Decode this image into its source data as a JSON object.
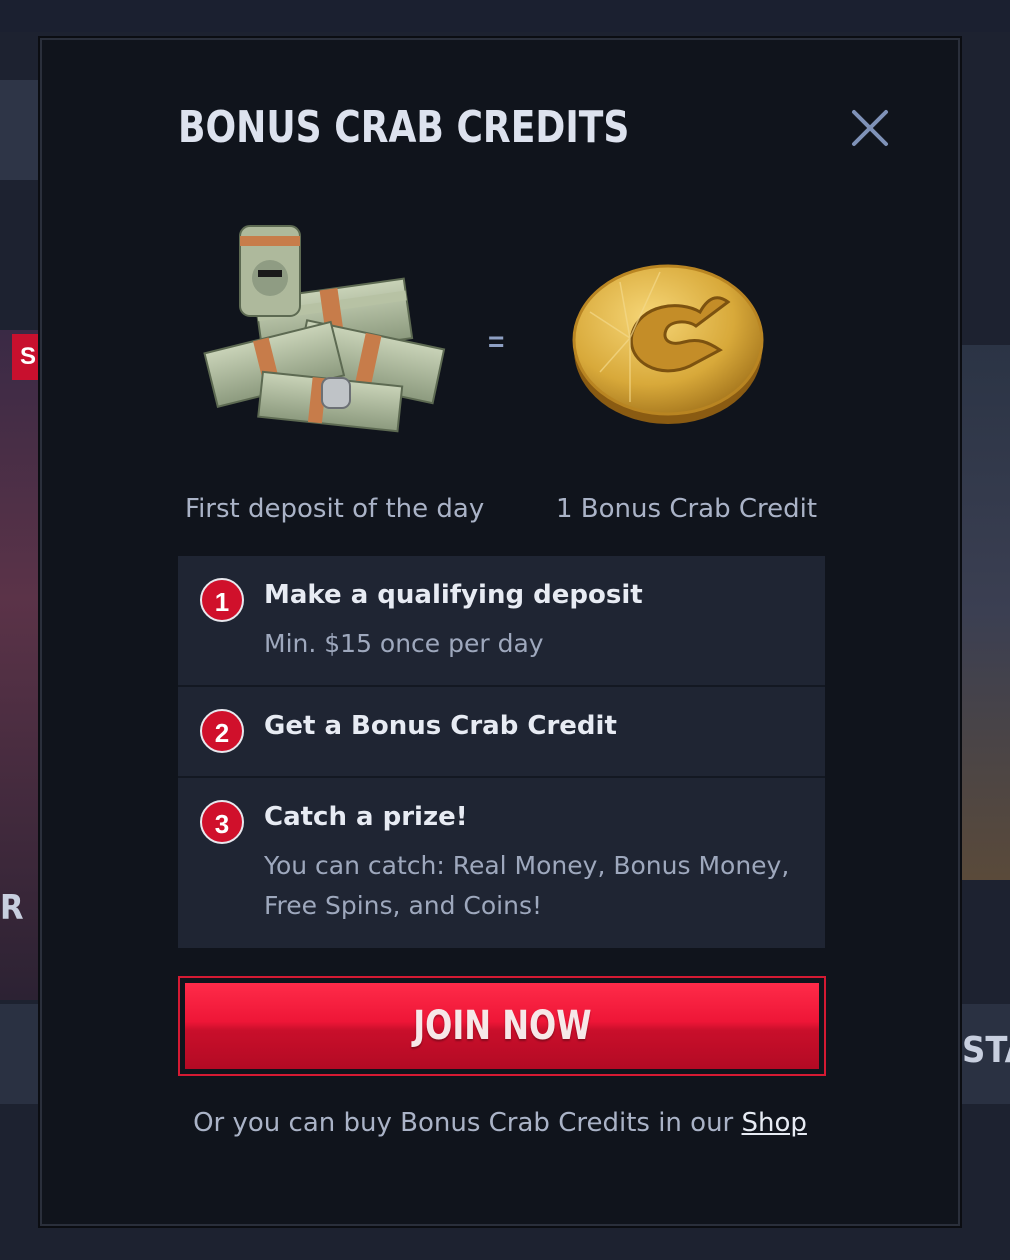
{
  "modal": {
    "title": "BONUS CRAB CREDITS",
    "close_icon": "close-icon",
    "equals": "=",
    "caption_left": "First deposit of the day",
    "caption_right": "1 Bonus Crab Credit",
    "steps": [
      {
        "number": "1",
        "title": "Make a qualifying deposit",
        "desc": "Min. $15 once per day"
      },
      {
        "number": "2",
        "title": "Get a Bonus Crab Credit",
        "desc": ""
      },
      {
        "number": "3",
        "title": "Catch a prize!",
        "desc": "You can catch: Real Money, Bonus Money, Free Spins, and Coins!"
      }
    ],
    "join_label": "JOIN NOW",
    "footer_prefix": "Or you can buy Bonus Crab Credits in our ",
    "footer_link": "Shop"
  },
  "background": {
    "left_badge": "S",
    "left_text": "R",
    "right_text": "STA"
  },
  "colors": {
    "accent_red": "#d0102b",
    "modal_bg": "#10141c",
    "step_bg": "#1f2533"
  }
}
